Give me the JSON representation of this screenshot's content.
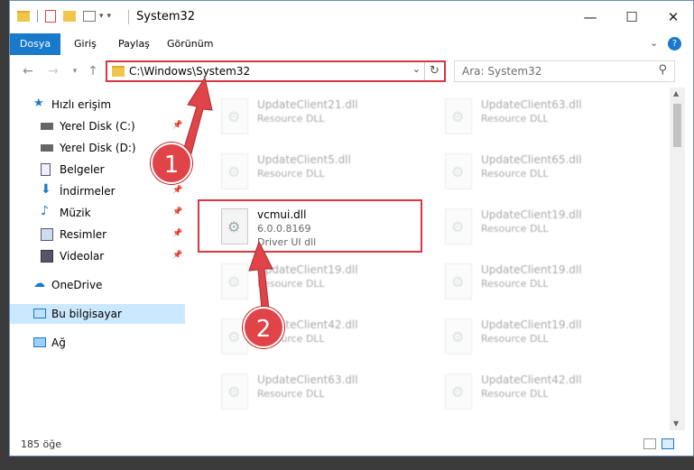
{
  "window": {
    "title": "System32",
    "controls": {
      "minimize": "—",
      "maximize": "☐",
      "close": "✕"
    }
  },
  "ribbon": {
    "tabs": [
      "Dosya",
      "Giriş",
      "Paylaş",
      "Görünüm"
    ]
  },
  "navbar": {
    "address": "C:\\Windows\\System32",
    "search_placeholder": "Ara: System32"
  },
  "sidebar": {
    "items": [
      {
        "label": "Hızlı erişim",
        "icon": "star-icon",
        "pinned": false
      },
      {
        "label": "Yerel Disk (C:)",
        "icon": "drive-icon",
        "pinned": true
      },
      {
        "label": "Yerel Disk (D:)",
        "icon": "drive-icon",
        "pinned": false
      },
      {
        "label": "Belgeler",
        "icon": "documents-icon",
        "pinned": true
      },
      {
        "label": "İndirmeler",
        "icon": "download-icon",
        "pinned": true
      },
      {
        "label": "Müzik",
        "icon": "music-icon",
        "pinned": true
      },
      {
        "label": "Resimler",
        "icon": "pictures-icon",
        "pinned": true
      },
      {
        "label": "Videolar",
        "icon": "videos-icon",
        "pinned": true
      },
      {
        "label": "OneDrive",
        "icon": "cloud-icon",
        "pinned": false
      },
      {
        "label": "Bu bilgisayar",
        "icon": "computer-icon",
        "pinned": false
      },
      {
        "label": "Ağ",
        "icon": "network-icon",
        "pinned": false
      }
    ]
  },
  "files": {
    "left": [
      {
        "name": "UpdateClient21.dll",
        "desc": "Resource DLL"
      },
      {
        "name": "UpdateClient5.dll",
        "desc": "Resource DLL"
      },
      {
        "name": "UpdateClient19.dll",
        "desc": "Resource DLL"
      },
      {
        "name": "UpdateClient42.dll",
        "desc": "Resource DLL"
      },
      {
        "name": "UpdateClient63.dll",
        "desc": "Resource DLL"
      }
    ],
    "right": [
      {
        "name": "UpdateClient63.dll",
        "desc": "Resource DLL"
      },
      {
        "name": "UpdateClient65.dll",
        "desc": "Resource DLL"
      },
      {
        "name": "UpdateClient19.dll",
        "desc": "Resource DLL"
      },
      {
        "name": "UpdateClient19.dll",
        "desc": "Resource DLL"
      },
      {
        "name": "UpdateClient19.dll",
        "desc": "Resource DLL"
      },
      {
        "name": "UpdateClient42.dll",
        "desc": "Resource DLL"
      }
    ],
    "highlighted": {
      "name": "vcmui.dll",
      "version": "6.0.0.8169",
      "desc": "Driver UI dll"
    }
  },
  "status": {
    "count": "185 öğe"
  },
  "callouts": {
    "one": "1",
    "two": "2"
  },
  "colors": {
    "accent": "#1979ca",
    "highlight": "#d73740",
    "selected": "#cce8ff"
  }
}
